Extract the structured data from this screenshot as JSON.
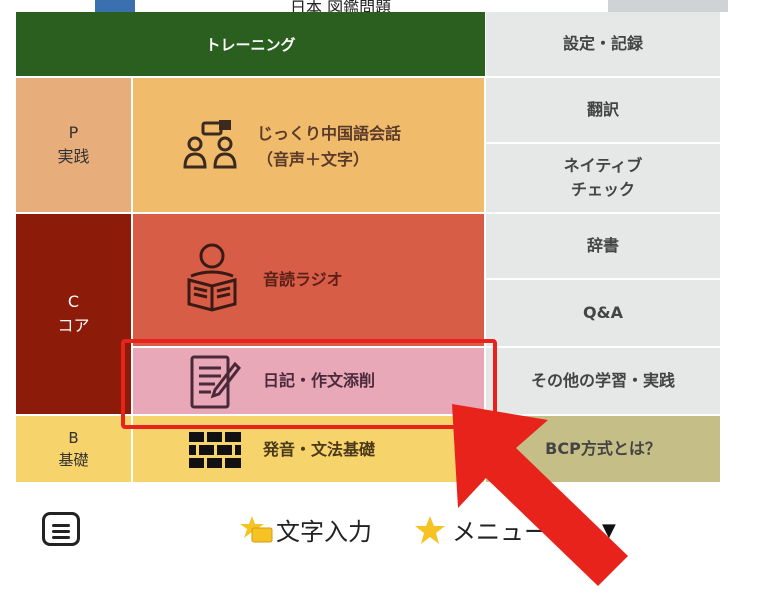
{
  "header": {
    "training": "トレーニング"
  },
  "left_labels": {
    "p": {
      "letter": "P",
      "name": "実践"
    },
    "c": {
      "letter": "C",
      "name": "コア"
    },
    "b": {
      "letter": "B",
      "name": "基礎"
    }
  },
  "training_items": [
    {
      "label": "じっくり中国語会話",
      "sub": "（音声＋文字）"
    },
    {
      "label": "音読ラジオ"
    },
    {
      "label": "日記・作文添削"
    },
    {
      "label": "発音・文法基礎"
    }
  ],
  "right_menu": [
    {
      "label": "設定・記録"
    },
    {
      "label": "翻訳"
    },
    {
      "label_line1": "ネイティブ",
      "label_line2": "チェック"
    },
    {
      "label": "辞書"
    },
    {
      "label": "Q&A"
    },
    {
      "label": "その他の学習・実践"
    },
    {
      "label": "BCP方式とは？"
    }
  ],
  "bottom_bar": {
    "text_input": "文字入力",
    "menu": "メニュー",
    "keyboard_icon": "keyboard-icon",
    "star_icon": "star-icon"
  },
  "top_strip": {
    "cut_text": "日本 図鑑問題"
  },
  "colors": {
    "header_green": "#2b5f1f",
    "practice_orange": "#f0bc6c",
    "core_red": "#d85d47",
    "core_dark": "#8d1b0a",
    "basics_yellow": "#f7d36b",
    "highlight_red": "#e8231b",
    "diary_pink": "#e8a8b8"
  }
}
